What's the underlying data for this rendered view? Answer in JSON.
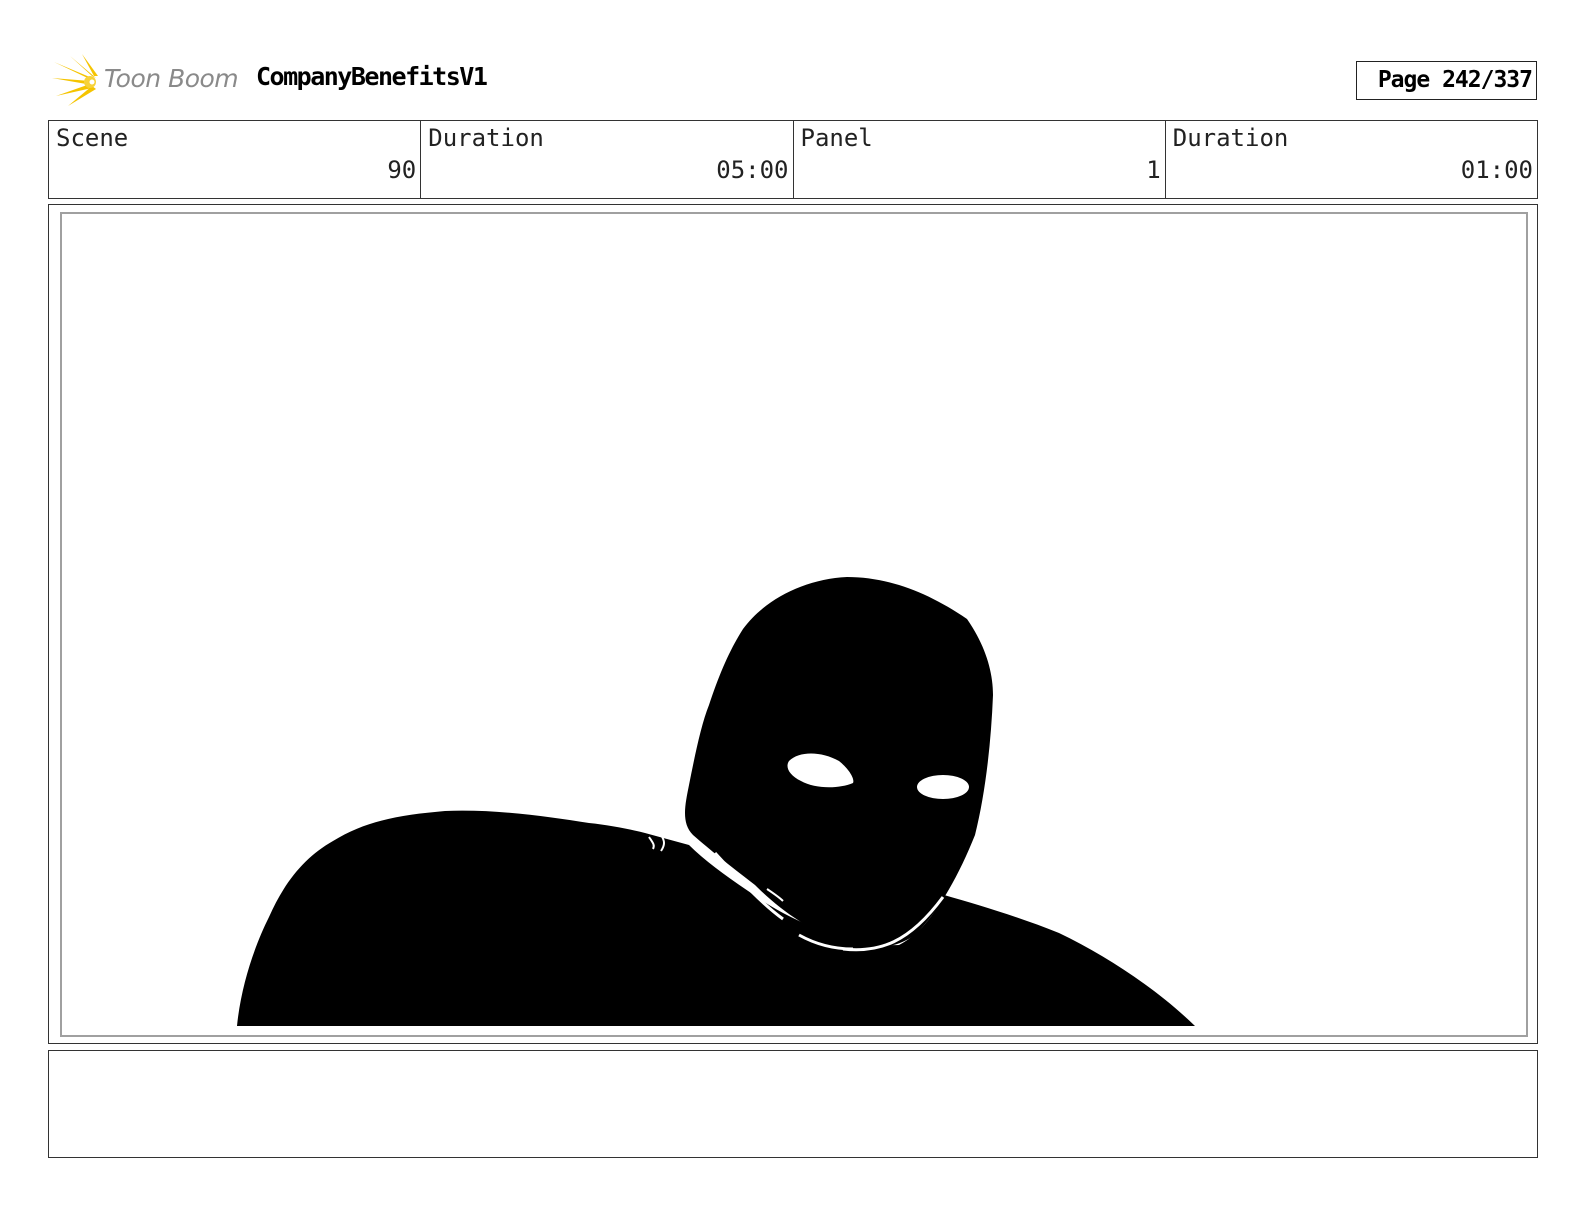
{
  "header": {
    "logo_text": "Toon Boom",
    "project_title": "CompanyBenefitsV1",
    "page_label": "Page 242/337"
  },
  "info": {
    "scene_label": "Scene",
    "scene_value": "90",
    "scene_duration_label": "Duration",
    "scene_duration_value": "05:00",
    "panel_label": "Panel",
    "panel_value": "1",
    "panel_duration_label": "Duration",
    "panel_duration_value": "01:00"
  },
  "panel": {
    "silhouette_color": "#000000",
    "background_color": "#ffffff"
  },
  "colors": {
    "logo_flare": "#f5c400",
    "logo_text": "#8a8a8a",
    "frame_border": "#333333",
    "safe_area_border": "#a0a0a0"
  }
}
